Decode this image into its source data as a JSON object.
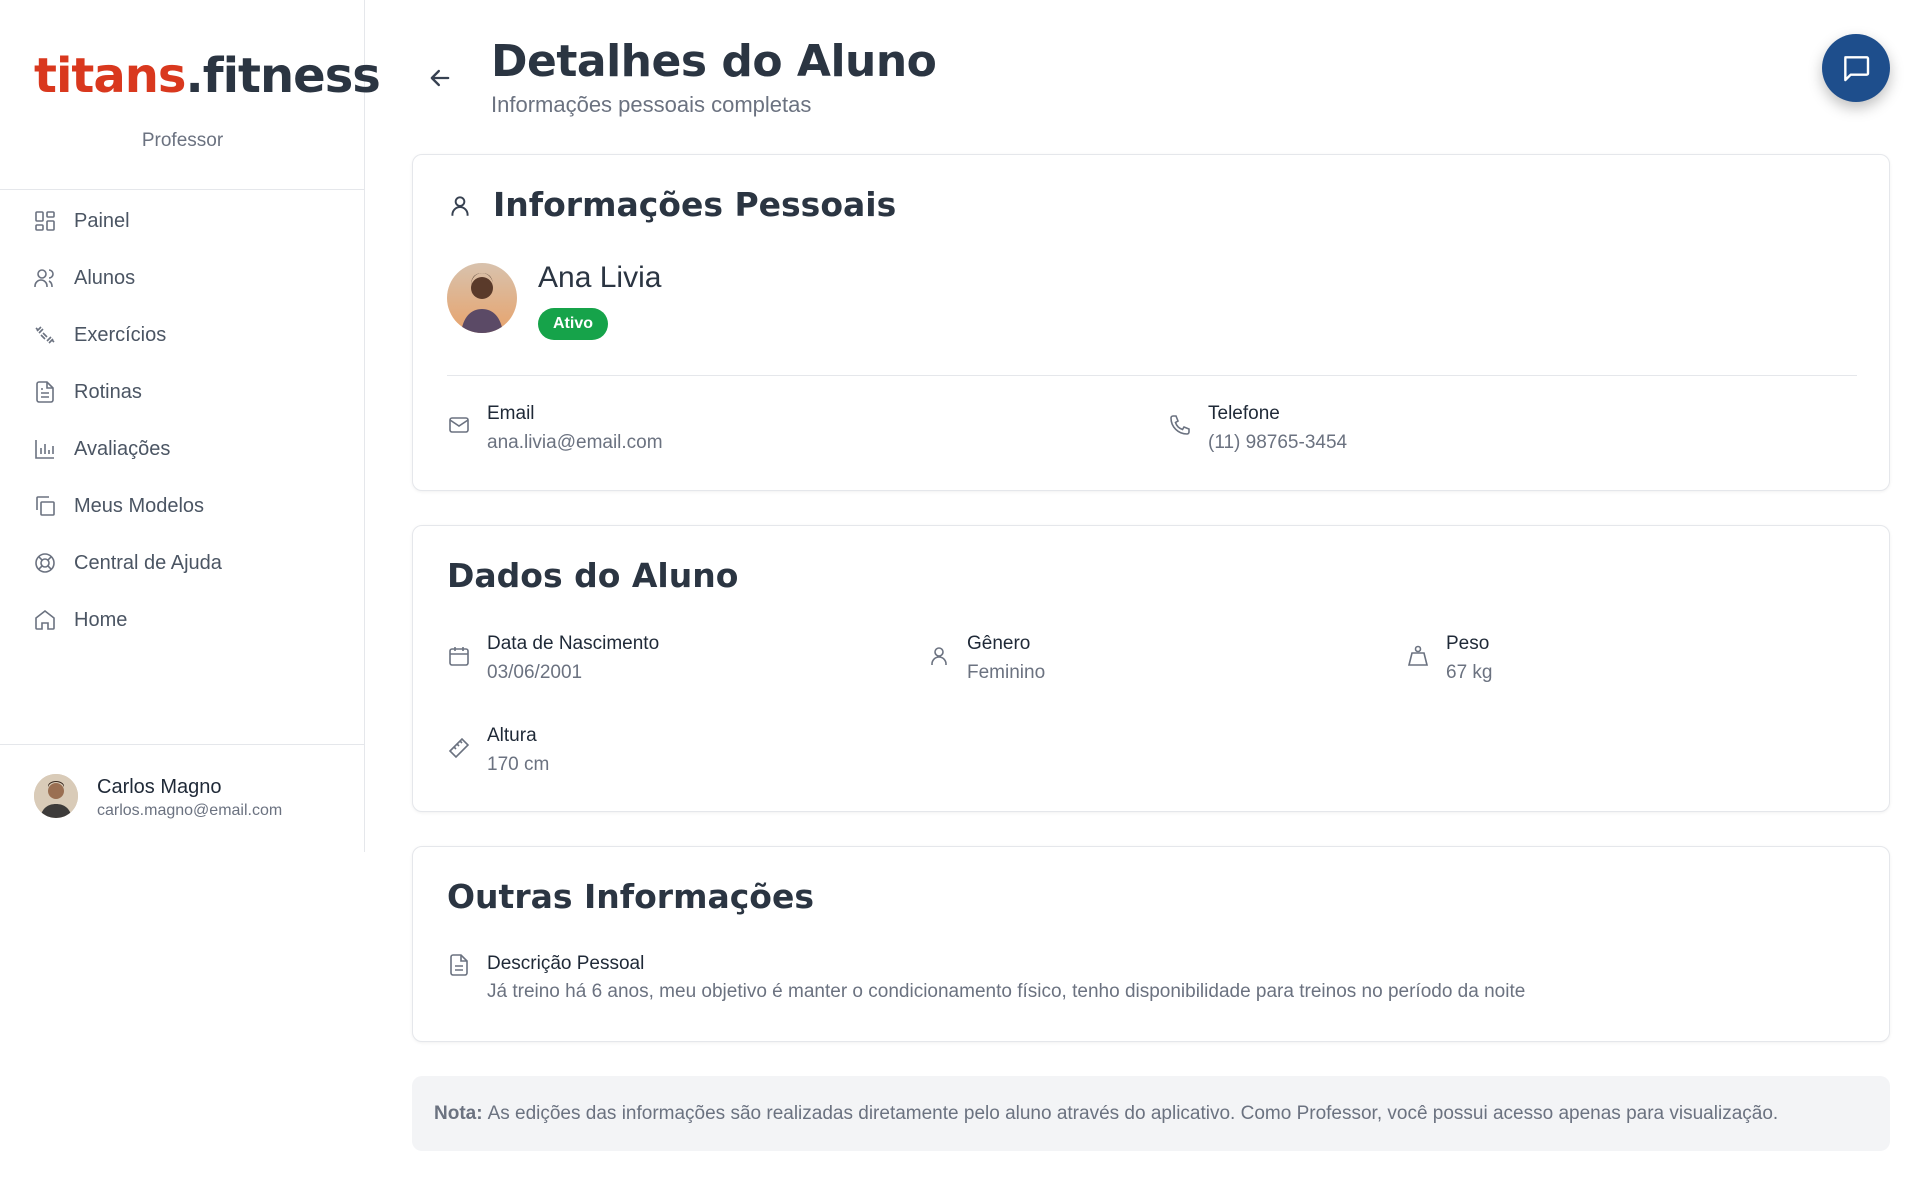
{
  "app": {
    "brand_part1": "titans",
    "brand_part2": ".fitness",
    "role": "Professor"
  },
  "sidebar": {
    "items": [
      {
        "label": "Painel",
        "icon": "grid-icon"
      },
      {
        "label": "Alunos",
        "icon": "users-icon"
      },
      {
        "label": "Exercícios",
        "icon": "dumbbell-icon"
      },
      {
        "label": "Rotinas",
        "icon": "file-text-icon"
      },
      {
        "label": "Avaliações",
        "icon": "bar-chart-icon"
      },
      {
        "label": "Meus Modelos",
        "icon": "copy-icon"
      },
      {
        "label": "Central de Ajuda",
        "icon": "lifebuoy-icon"
      },
      {
        "label": "Home",
        "icon": "home-icon"
      }
    ],
    "user": {
      "name": "Carlos Magno",
      "email": "carlos.magno@email.com"
    }
  },
  "header": {
    "title": "Detalhes do Aluno",
    "subtitle": "Informações pessoais completas"
  },
  "personal": {
    "title": "Informações Pessoais",
    "name": "Ana Livia",
    "status": "Ativo",
    "email_label": "Email",
    "email_value": "ana.livia@email.com",
    "phone_label": "Telefone",
    "phone_value": "(11) 98765-3454"
  },
  "student_data": {
    "title": "Dados do Aluno",
    "birth_label": "Data de Nascimento",
    "birth_value": "03/06/2001",
    "gender_label": "Gênero",
    "gender_value": "Feminino",
    "weight_label": "Peso",
    "weight_value": "67 kg",
    "height_label": "Altura",
    "height_value": "170 cm"
  },
  "other": {
    "title": "Outras Informações",
    "desc_label": "Descrição Pessoal",
    "desc_value": "Já treino há 6 anos, meu objetivo é manter o condicionamento físico, tenho disponibilidade para treinos no período da noite"
  },
  "note": {
    "label": "Nota:",
    "text": "As edições das informações são realizadas diretamente pelo aluno através do aplicativo. Como Professor, você possui acesso apenas para visualização."
  },
  "colors": {
    "brand_red": "#d9381e",
    "brand_dark": "#2b3542",
    "status_green": "#16a34a",
    "chat_blue": "#1e4e8c"
  }
}
